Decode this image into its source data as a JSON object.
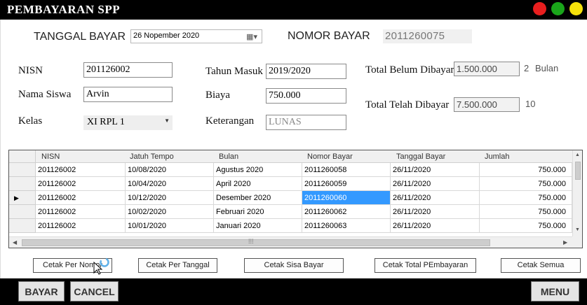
{
  "window": {
    "title": "PEMBAYARAN SPP",
    "controls": [
      {
        "name": "close",
        "color": "#e81e1e"
      },
      {
        "name": "maximize",
        "color": "#1aa51a"
      },
      {
        "name": "minimize",
        "color": "#f5e10a"
      }
    ]
  },
  "header": {
    "tanggal_label": "TANGGAL BAYAR",
    "tanggal_value": "26 Nopember 2020",
    "nomor_label": "NOMOR BAYAR",
    "nomor_value": "2011260075"
  },
  "form": {
    "nisn_label": "NISN",
    "nisn_value": "201126002",
    "nama_label": "Nama Siswa",
    "nama_value": "Arvin",
    "kelas_label": "Kelas",
    "kelas_value": "XI RPL 1",
    "tahun_label": "Tahun Masuk",
    "tahun_value": "2019/2020",
    "biaya_label": "Biaya",
    "biaya_value": "750.000",
    "keterangan_label": "Keterangan",
    "keterangan_value": "LUNAS",
    "belum_label": "Total Belum Dibayar",
    "belum_value": "1.500.000",
    "belum_count": "2",
    "belum_unit": "Bulan",
    "telah_label": "Total Telah Dibayar",
    "telah_value": "7.500.000",
    "telah_count": "10"
  },
  "grid": {
    "columns": [
      "NISN",
      "Jatuh Tempo",
      "Bulan",
      "Nomor Bayar",
      "Tanggal Bayar",
      "Jumlah"
    ],
    "current_row_marker": "▶",
    "rows": [
      [
        "201126002",
        "10/08/2020",
        "Agustus 2020",
        "2011260058",
        "26/11/2020",
        "750.000"
      ],
      [
        "201126002",
        "10/04/2020",
        "April 2020",
        "2011260059",
        "26/11/2020",
        "750.000"
      ],
      [
        "201126002",
        "10/12/2020",
        "Desember 2020",
        "2011260060",
        "26/11/2020",
        "750.000"
      ],
      [
        "201126002",
        "10/02/2020",
        "Februari 2020",
        "2011260062",
        "26/11/2020",
        "750.000"
      ],
      [
        "201126002",
        "10/01/2020",
        "Januari 2020",
        "2011260063",
        "26/11/2020",
        "750.000"
      ]
    ],
    "selected": {
      "row": 2,
      "col": 3
    }
  },
  "actions": {
    "cetak_nomor": "Cetak Per Nomor",
    "cetak_tanggal": "Cetak Per Tanggal",
    "cetak_sisa": "Cetak Sisa Bayar",
    "cetak_total": "Cetak Total PEmbayaran",
    "cetak_semua": "Cetak Semua"
  },
  "footer": {
    "bayar": "BAYAR",
    "cancel": "CANCEL",
    "menu": "MENU"
  }
}
